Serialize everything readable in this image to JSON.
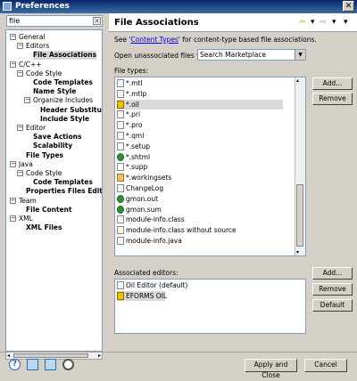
{
  "window": {
    "title": "Preferences",
    "close_glyph": "✕"
  },
  "filter": {
    "value": "file",
    "clear_glyph": "✕"
  },
  "tree": [
    {
      "label": "General",
      "toggle": "−",
      "bold": false,
      "level": 0
    },
    {
      "label": "Editors",
      "toggle": "−",
      "bold": false,
      "level": 1
    },
    {
      "label": "File Associations",
      "toggle": "",
      "bold": true,
      "level": 2,
      "selected": true
    },
    {
      "label": "C/C++",
      "toggle": "−",
      "bold": false,
      "level": 0
    },
    {
      "label": "Code Style",
      "toggle": "−",
      "bold": false,
      "level": 1
    },
    {
      "label": "Code Templates",
      "toggle": "",
      "bold": true,
      "level": 2
    },
    {
      "label": "Name Style",
      "toggle": "",
      "bold": true,
      "level": 2
    },
    {
      "label": "Organize Includes",
      "toggle": "−",
      "bold": false,
      "level": 2
    },
    {
      "label": "Header Substituti",
      "toggle": "",
      "bold": true,
      "level": 3
    },
    {
      "label": "Include Style",
      "toggle": "",
      "bold": true,
      "level": 3
    },
    {
      "label": "Editor",
      "toggle": "−",
      "bold": false,
      "level": 1
    },
    {
      "label": "Save Actions",
      "toggle": "",
      "bold": true,
      "level": 2
    },
    {
      "label": "Scalability",
      "toggle": "",
      "bold": true,
      "level": 2
    },
    {
      "label": "File Types",
      "toggle": "",
      "bold": true,
      "level": 1
    },
    {
      "label": "Java",
      "toggle": "−",
      "bold": false,
      "level": 0
    },
    {
      "label": "Code Style",
      "toggle": "−",
      "bold": false,
      "level": 1
    },
    {
      "label": "Code Templates",
      "toggle": "",
      "bold": true,
      "level": 2
    },
    {
      "label": "Properties Files Editor",
      "toggle": "",
      "bold": true,
      "level": 1
    },
    {
      "label": "Team",
      "toggle": "−",
      "bold": false,
      "level": 0
    },
    {
      "label": "File Content",
      "toggle": "",
      "bold": true,
      "level": 1
    },
    {
      "label": "XML",
      "toggle": "−",
      "bold": false,
      "level": 0
    },
    {
      "label": "XML Files",
      "toggle": "",
      "bold": true,
      "level": 1
    }
  ],
  "page": {
    "title": "File Associations",
    "nav": {
      "back": "⇦",
      "dropdown": "▾",
      "forward": "⇨",
      "menu": "▾"
    },
    "desc_prefix": "See '",
    "desc_link": "Content Types",
    "desc_suffix": "' for content-type based file associations.",
    "open_label": "Open unassociated files with:",
    "open_value": "Search Marketplace",
    "file_types_label": "File types:",
    "assoc_label": "Associated editors:"
  },
  "file_types": [
    {
      "name": "*.mtl",
      "icon": "blank"
    },
    {
      "name": "*.mtlp",
      "icon": "blank"
    },
    {
      "name": "*.oil",
      "icon": "lock",
      "selected": true
    },
    {
      "name": "*.pri",
      "icon": "blank"
    },
    {
      "name": "*.pro",
      "icon": "blank"
    },
    {
      "name": "*.qml",
      "icon": "blank"
    },
    {
      "name": "*.setup",
      "icon": "blank"
    },
    {
      "name": "*.shtml",
      "icon": "globe"
    },
    {
      "name": "*.supp",
      "icon": "v"
    },
    {
      "name": "*.workingsets",
      "icon": "folder"
    },
    {
      "name": "ChangeLog",
      "icon": "blank"
    },
    {
      "name": "gmon.out",
      "icon": "globe"
    },
    {
      "name": "gmon.sum",
      "icon": "globe"
    },
    {
      "name": "module-info.class",
      "icon": "blank"
    },
    {
      "name": "module-info.class without source",
      "icon": "j"
    },
    {
      "name": "module-info.java",
      "icon": "blank"
    }
  ],
  "editors": [
    {
      "name": "Oil Editor (default)",
      "icon": "blank"
    },
    {
      "name": "EFORMS OIL",
      "icon": "lock",
      "selected": true
    }
  ],
  "buttons": {
    "add_types": "Add...",
    "remove_types": "Remove",
    "add_editors": "Add...",
    "remove_editors": "Remove",
    "default_editor": "Default",
    "apply_close": "Apply and Close",
    "cancel": "Cancel"
  },
  "bottom_icons": [
    "help-icon",
    "import-icon",
    "export-icon",
    "record-icon"
  ]
}
